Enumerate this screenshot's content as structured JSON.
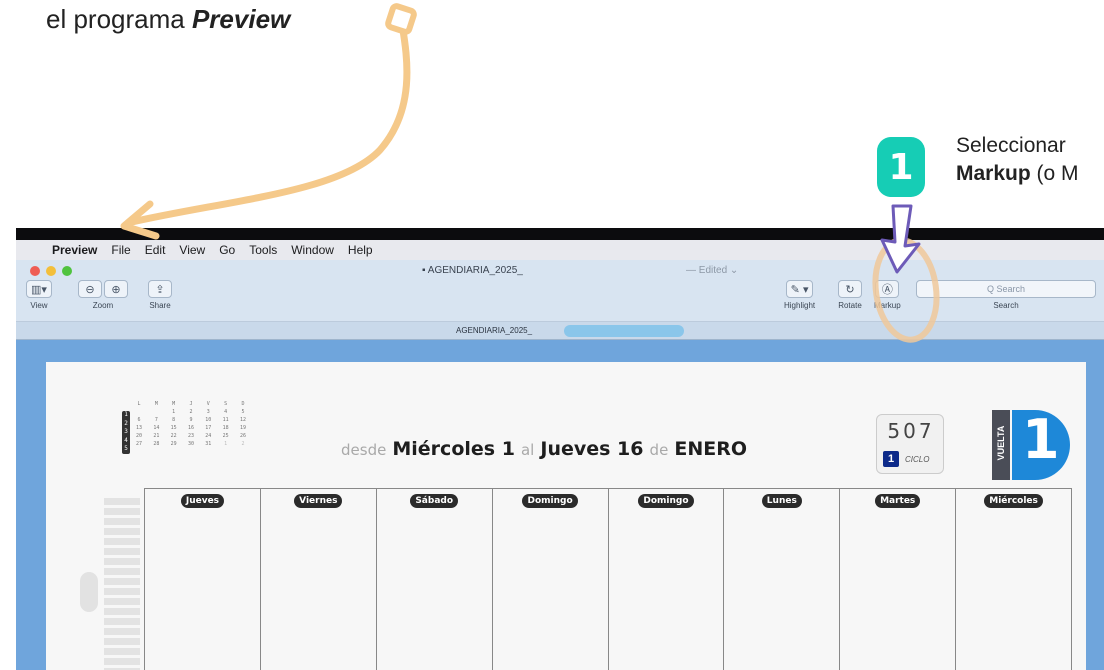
{
  "annotations": {
    "caption_prefix": "el programa ",
    "caption_app": "Preview",
    "step_number": "1",
    "step_line1": "Seleccionar",
    "step_line2_bold": "Markup",
    "step_line2_rest": " (o M",
    "accent_color": "#16cdb5",
    "arrow_color": "#f5c98a"
  },
  "menubar": {
    "apple_icon": "apple-icon",
    "items": [
      "Preview",
      "File",
      "Edit",
      "View",
      "Go",
      "Tools",
      "Window",
      "Help"
    ]
  },
  "window": {
    "title": "AGENDIARIA_2025_",
    "edited": "— Edited ⌄",
    "tab_title": "AGENDIARIA_2025_",
    "toolbar": {
      "view_label": "View",
      "zoom_label": "Zoom",
      "share_label": "Share",
      "highlight_label": "Highlight",
      "rotate_label": "Rotate",
      "markup_label": "Markup",
      "search_placeholder": "Q Search",
      "search_label": "Search"
    }
  },
  "document": {
    "mini_calendar": {
      "headers": [
        "L",
        "M",
        "M",
        "J",
        "V",
        "S",
        "D"
      ],
      "weeks": [
        [
          "",
          "",
          "1",
          "2",
          "3",
          "4",
          "5"
        ],
        [
          "6",
          "7",
          "8",
          "9",
          "10",
          "11",
          "12"
        ],
        [
          "13",
          "14",
          "15",
          "16",
          "17",
          "18",
          "19"
        ],
        [
          "20",
          "21",
          "22",
          "23",
          "24",
          "25",
          "26"
        ],
        [
          "27",
          "28",
          "29",
          "30",
          "31",
          "1",
          "2"
        ]
      ],
      "week_numbers": [
        "1",
        "2",
        "3",
        "4",
        "5"
      ]
    },
    "headline": {
      "w1": "desde",
      "w2": "Miércoles 1",
      "w3": "al",
      "w4": "Jueves 16",
      "w5": "de",
      "w6": "ENERO"
    },
    "counter": {
      "number": "507",
      "cycle_number": "1",
      "cycle_label": "CICLO"
    },
    "logo": {
      "vertical_text": "VUELTA",
      "numeral": "1"
    },
    "days": [
      "Jueves",
      "Viernes",
      "Sábado",
      "Domingo",
      "Domingo",
      "Lunes",
      "Martes",
      "Miércoles"
    ]
  }
}
